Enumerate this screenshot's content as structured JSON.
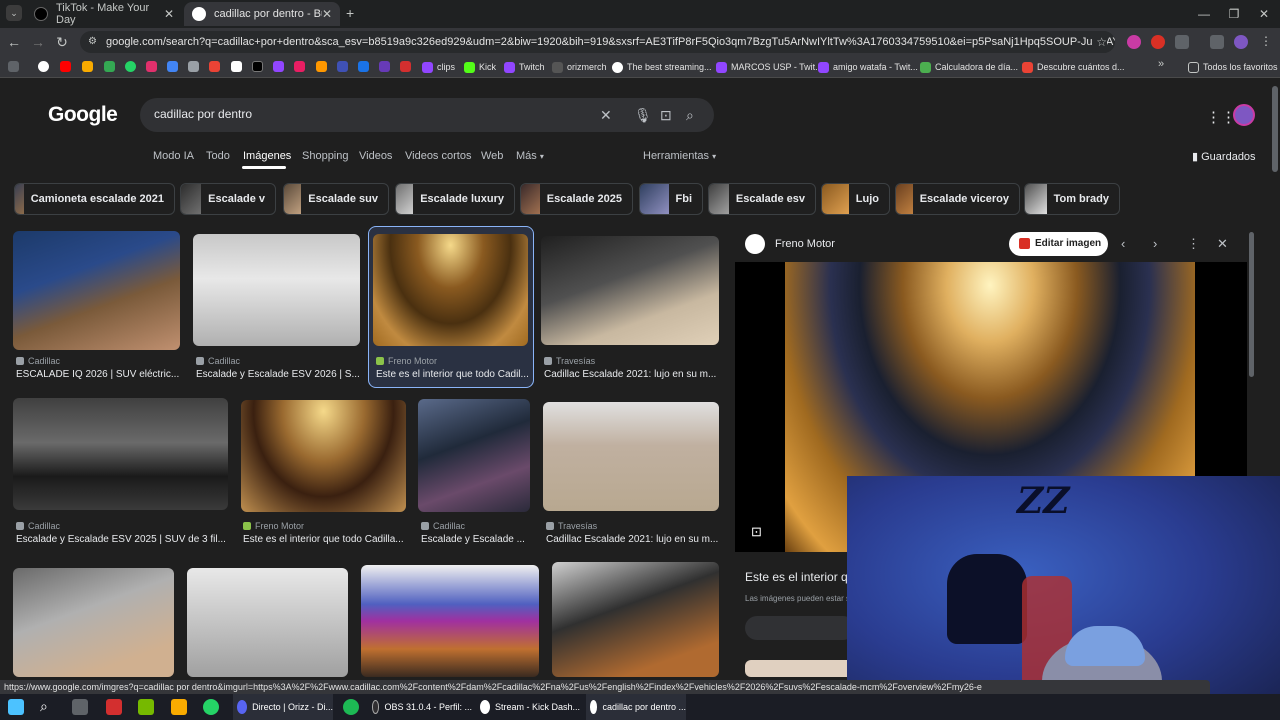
{
  "tabs": [
    {
      "title": "TikTok - Make Your Day",
      "active": false
    },
    {
      "title": "cadillac por dentro - Buscar co",
      "active": true
    }
  ],
  "address_bar": {
    "url": "google.com/search?q=cadillac+por+dentro&sca_esv=b8519a9c326ed929&udm=2&biw=1920&bih=919&sxsrf=AE3TifP8rF5Qio3qm7BzgTu5ArNwIYltTw%3A1760334759510&ei=p5PsaNj1Hpq5SOUP-JuXuAY&oq=CADILLAC+por+de&gs..."
  },
  "bookmarks": [
    {
      "label": "clips"
    },
    {
      "label": "Kick"
    },
    {
      "label": "Twitch"
    },
    {
      "label": "orizmerch"
    },
    {
      "label": "The best streaming..."
    },
    {
      "label": "MARCOS USP - Twit..."
    },
    {
      "label": "amigo watafa - Twit..."
    },
    {
      "label": "Calculadora de día..."
    },
    {
      "label": "Descubre cuántos d..."
    },
    {
      "label": "Todos los favoritos"
    }
  ],
  "google": {
    "logo": "Google",
    "query": "cadillac por dentro",
    "tabs": [
      "Modo IA",
      "Todo",
      "Imágenes",
      "Shopping",
      "Videos",
      "Videos cortos",
      "Web",
      "Más"
    ],
    "tools": "Herramientas",
    "saved": "Guardados",
    "chips": [
      "Camioneta escalade 2021",
      "Escalade v",
      "Escalade suv",
      "Escalade luxury",
      "Escalade 2025",
      "Fbi",
      "Escalade esv",
      "Lujo",
      "Escalade viceroy",
      "Tom brady"
    ],
    "results": [
      {
        "source": "Cadillac",
        "caption": "ESCALADE IQ 2026 | SUV eléctric..."
      },
      {
        "source": "Cadillac",
        "caption": "Escalade y Escalade ESV 2026 | S..."
      },
      {
        "source": "Freno Motor",
        "caption": "Este es el interior que todo Cadil..."
      },
      {
        "source": "Travesías",
        "caption": "Cadillac Escalade 2021: lujo en su m..."
      },
      {
        "source": "Cadillac",
        "caption": "Escalade y Escalade ESV 2025 | SUV de 3 fil..."
      },
      {
        "source": "Freno Motor",
        "caption": "Este es el interior que todo Cadilla..."
      },
      {
        "source": "Cadillac",
        "caption": "Escalade y Escalade ..."
      },
      {
        "source": "Travesías",
        "caption": "Cadillac Escalade 2021: lujo en su m..."
      }
    ]
  },
  "preview": {
    "source": "Freno Motor",
    "edit_button": "Editar imagen",
    "title": "Este es el interior q",
    "note": "Las imágenes pueden estar s"
  },
  "status_url": "https://www.google.com/imgres?q=cadillac por dentro&imgurl=https%3A%2F%2Fwww.cadillac.com%2Fcontent%2Fdam%2Fcadillac%2Fna%2Fus%2Fenglish%2Findex%2Fvehicles%2F2026%2Fsuvs%2Fescalade-mcm%2Foverview%2Fmy26-e",
  "taskbar": [
    {
      "label": "Directo | Orizz - Di..."
    },
    {
      "label": "OBS 31.0.4 - Perfil: ..."
    },
    {
      "label": "Stream - Kick Dash..."
    },
    {
      "label": "cadillac por dentro ..."
    }
  ],
  "webcam_overlay": "ZZ",
  "colors": {
    "accent": "#8ab4f8",
    "background": "#1f1f1f",
    "chrome_toolbar": "#35363a"
  }
}
